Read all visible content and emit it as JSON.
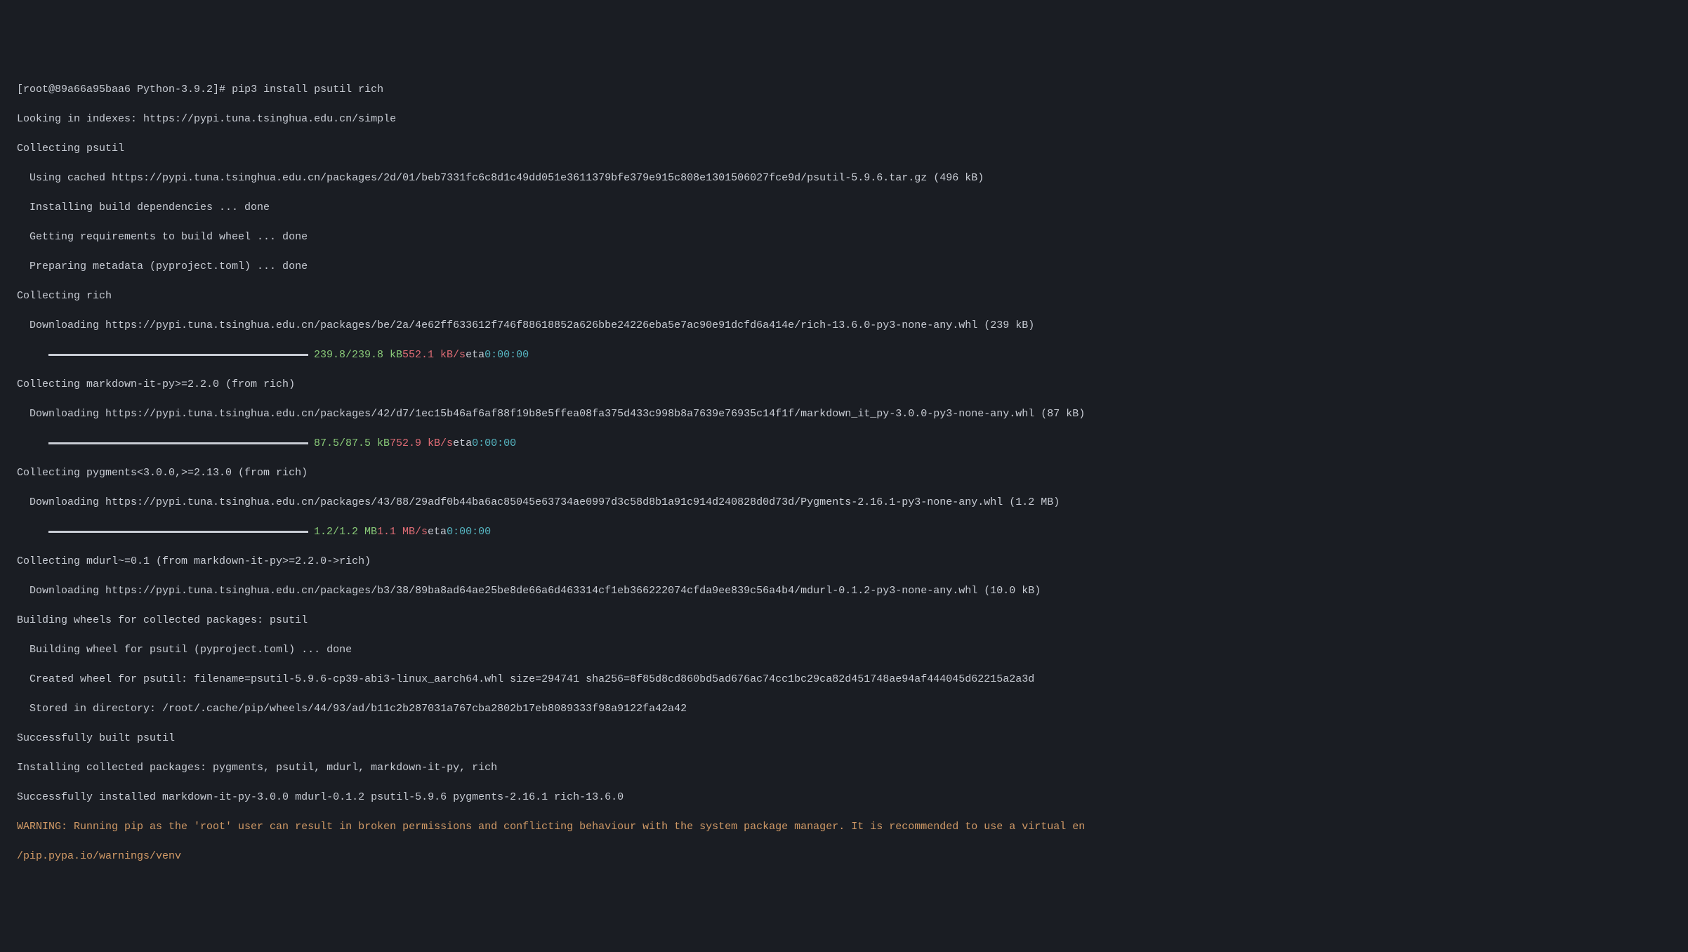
{
  "prompt": {
    "prefix": "[root@89a66a95baa6 Python-3.9.2]# ",
    "command": "pip3 install psutil rich"
  },
  "lines": {
    "l1": "Looking in indexes: https://pypi.tuna.tsinghua.edu.cn/simple",
    "l2": "Collecting psutil",
    "l3": "  Using cached https://pypi.tuna.tsinghua.edu.cn/packages/2d/01/beb7331fc6c8d1c49dd051e3611379bfe379e915c808e1301506027fce9d/psutil-5.9.6.tar.gz (496 kB)",
    "l4": "  Installing build dependencies ... done",
    "l5": "  Getting requirements to build wheel ... done",
    "l6": "  Preparing metadata (pyproject.toml) ... done",
    "l7": "Collecting rich",
    "l8": "  Downloading https://pypi.tuna.tsinghua.edu.cn/packages/be/2a/4e62ff633612f746f88618852a626bbe24226eba5e7ac90e91dcfd6a414e/rich-13.6.0-py3-none-any.whl (239 kB)",
    "l10": "Collecting markdown-it-py>=2.2.0 (from rich)",
    "l11": "  Downloading https://pypi.tuna.tsinghua.edu.cn/packages/42/d7/1ec15b46af6af88f19b8e5ffea08fa375d433c998b8a7639e76935c14f1f/markdown_it_py-3.0.0-py3-none-any.whl (87 kB)",
    "l13": "Collecting pygments<3.0.0,>=2.13.0 (from rich)",
    "l14": "  Downloading https://pypi.tuna.tsinghua.edu.cn/packages/43/88/29adf0b44ba6ac85045e63734ae0997d3c58d8b1a91c914d240828d0d73d/Pygments-2.16.1-py3-none-any.whl (1.2 MB)",
    "l16": "Collecting mdurl~=0.1 (from markdown-it-py>=2.2.0->rich)",
    "l17": "  Downloading https://pypi.tuna.tsinghua.edu.cn/packages/b3/38/89ba8ad64ae25be8de66a6d463314cf1eb366222074cfda9ee839c56a4b4/mdurl-0.1.2-py3-none-any.whl (10.0 kB)",
    "l18": "Building wheels for collected packages: psutil",
    "l19": "  Building wheel for psutil (pyproject.toml) ... done",
    "l20": "  Created wheel for psutil: filename=psutil-5.9.6-cp39-abi3-linux_aarch64.whl size=294741 sha256=8f85d8cd860bd5ad676ac74cc1bc29ca82d451748ae94af444045d62215a2a3d",
    "l21": "  Stored in directory: /root/.cache/pip/wheels/44/93/ad/b11c2b287031a767cba2802b17eb8089333f98a9122fa42a42",
    "l22": "Successfully built psutil",
    "l23": "Installing collected packages: pygments, psutil, mdurl, markdown-it-py, rich",
    "l24": "Successfully installed markdown-it-py-3.0.0 mdurl-0.1.2 psutil-5.9.6 pygments-2.16.1 rich-13.6.0",
    "l25": "WARNING: Running pip as the 'root' user can result in broken permissions and conflicting behaviour with the system package manager. It is recommended to use a virtual en",
    "l26": "/pip.pypa.io/warnings/venv"
  },
  "progress": {
    "indent": "     ",
    "p1": {
      "size_done": "239.8/239.8 kB",
      "speed": "552.1 kB/s",
      "eta_label": "eta",
      "eta_time": "0:00:00"
    },
    "p2": {
      "size_done": "87.5/87.5 kB",
      "speed": "752.9 kB/s",
      "eta_label": "eta",
      "eta_time": "0:00:00"
    },
    "p3": {
      "size_done": "1.2/1.2 MB",
      "speed": "1.1 MB/s",
      "eta_label": "eta",
      "eta_time": "0:00:00"
    }
  }
}
